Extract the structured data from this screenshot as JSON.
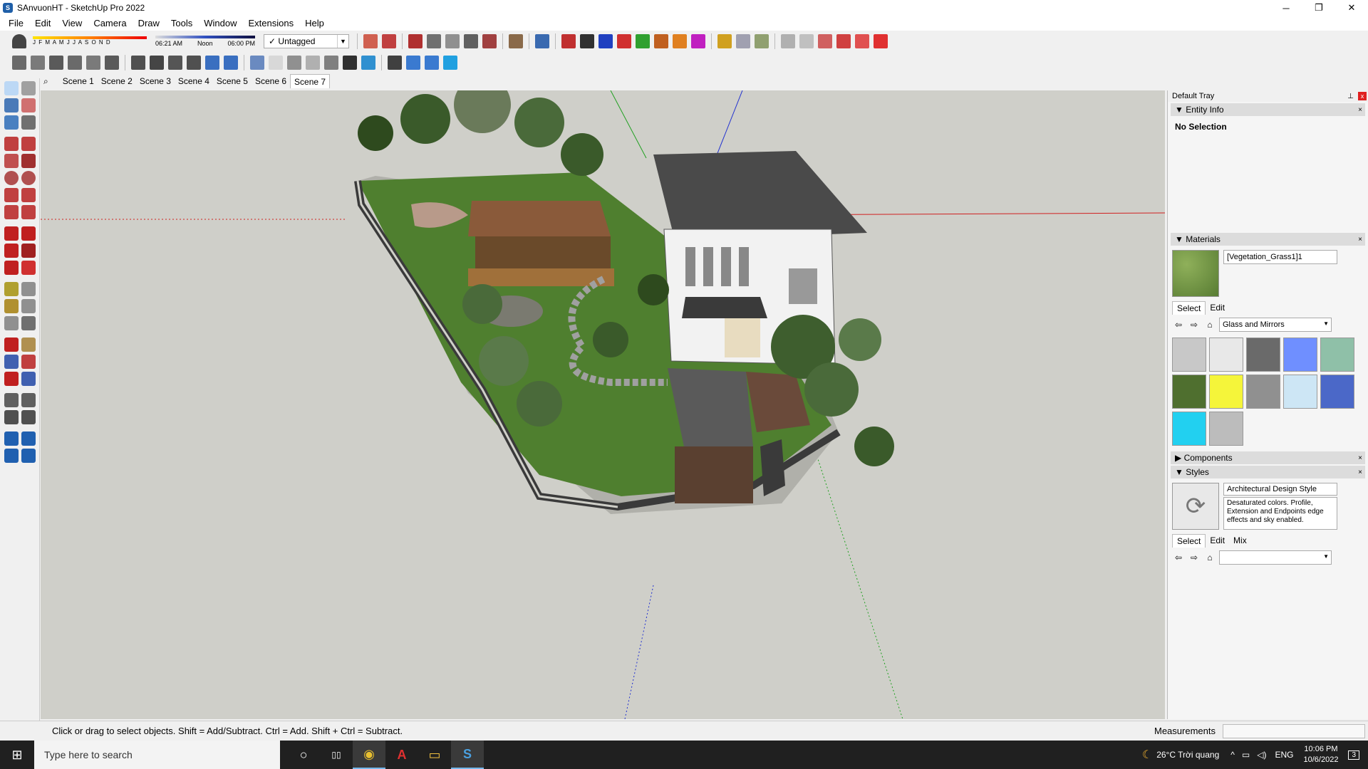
{
  "window": {
    "title": "SAnvuonHT - SketchUp Pro 2022",
    "app_icon_letter": "S",
    "minimize": "─",
    "maximize": "❐",
    "close": "✕"
  },
  "menu": [
    "File",
    "Edit",
    "View",
    "Camera",
    "Draw",
    "Tools",
    "Window",
    "Extensions",
    "Help"
  ],
  "shadow": {
    "months": "J F M A M J J A S O N D",
    "time_start": "06:21 AM",
    "time_mid": "Noon",
    "time_end": "06:00 PM"
  },
  "tag_select": {
    "check": "✓",
    "value": "Untagged",
    "arrow": "▼"
  },
  "search_icon": "⌕",
  "scenes": [
    "Scene 1",
    "Scene 2",
    "Scene 3",
    "Scene 4",
    "Scene 5",
    "Scene 6",
    "Scene 7"
  ],
  "active_scene": "Scene 7",
  "tray": {
    "title": "Default Tray",
    "pin": "⊥",
    "close": "x",
    "entity_info": {
      "label": "Entity Info",
      "arrow": "▼",
      "close": "×",
      "selection": "No Selection"
    },
    "materials": {
      "label": "Materials",
      "arrow": "▼",
      "close": "×",
      "current": "[Vegetation_Grass1]1",
      "tabs": [
        "Select",
        "Edit"
      ],
      "library": "Glass and Mirrors",
      "back": "⇦",
      "forward": "⇨",
      "home": "⌂",
      "dropdown": "▼",
      "swatches": [
        "#c8c8c8",
        "#e8e8e8",
        "#6a6a6a",
        "#6f8fff",
        "#8fc0a8",
        "#4f6f2f",
        "#f5f53a",
        "#909090",
        "#cde6f5",
        "#4b68c8",
        "#22d0f0",
        "#bcbcbc"
      ]
    },
    "components": {
      "label": "Components",
      "arrow": "▶",
      "close": "×"
    },
    "styles": {
      "label": "Styles",
      "arrow": "▼",
      "close": "×",
      "thumb": "⟳",
      "name": "Architectural Design Style",
      "description": "Desaturated colors. Profile, Extension and Endpoints edge effects and sky enabled.",
      "tabs": [
        "Select",
        "Edit",
        "Mix"
      ],
      "back": "⇦",
      "forward": "⇨",
      "home": "⌂",
      "dropdown": "▼"
    }
  },
  "status": {
    "text": "Click or drag to select objects. Shift = Add/Subtract. Ctrl = Add. Shift + Ctrl = Subtract.",
    "measurements_label": "Measurements"
  },
  "taskbar": {
    "start": "⊞",
    "search_placeholder": "Type here to search",
    "weather": "26°C  Trời quang",
    "lang": "ENG",
    "time": "10:06 PM",
    "date": "10/6/2022",
    "notif": "3",
    "cortana": "○",
    "taskview": "▯▯",
    "chrome": "◉",
    "autocad": "A",
    "explorer": "▭",
    "sketchup": "S"
  },
  "colors": {
    "red_axis": "#d02020",
    "green_axis": "#20a020",
    "blue_axis": "#2030d0"
  }
}
